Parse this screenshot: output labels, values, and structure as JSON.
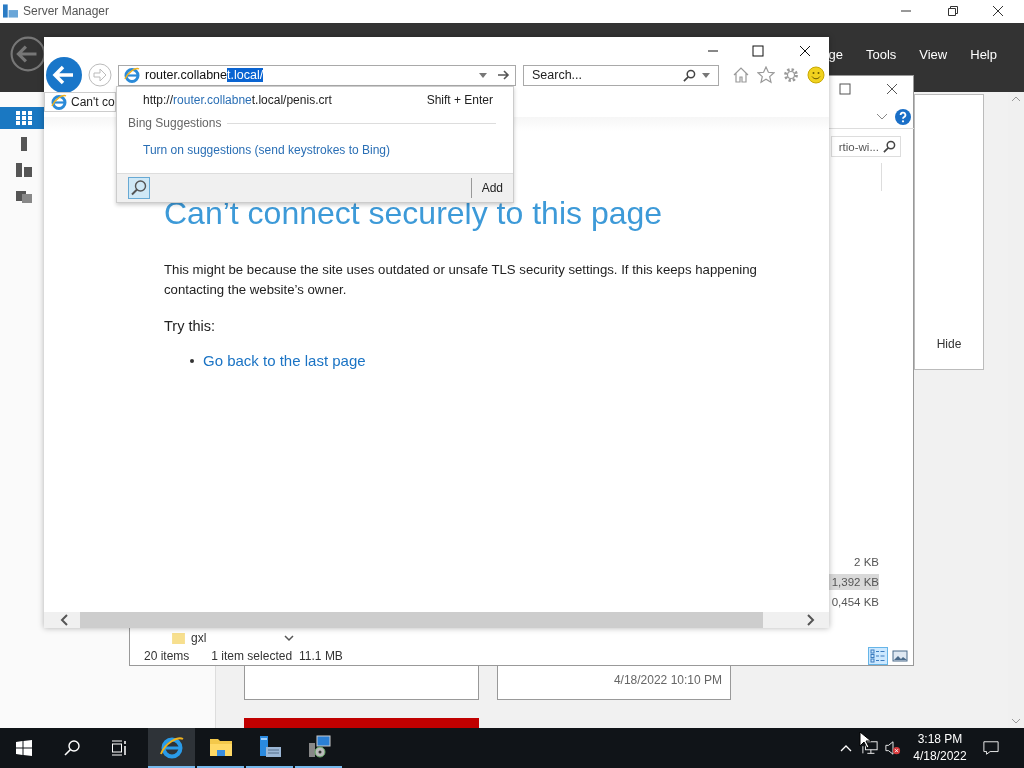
{
  "server_manager": {
    "title": "Server Manager",
    "menu": [
      "ge",
      "Tools",
      "View",
      "Help"
    ],
    "sidebar": [
      {
        "selected": true
      },
      {
        "selected": false
      },
      {
        "selected": false
      },
      {
        "selected": false
      }
    ],
    "hide_button": "Hide",
    "tile_date": "4/18/2022 10:10 PM"
  },
  "explorer": {
    "search_value": "rtio-wi...",
    "sizes": [
      {
        "text": "2 KB",
        "selected": false
      },
      {
        "text": "1,392 KB",
        "selected": true
      },
      {
        "text": "0,454 KB",
        "selected": false
      }
    ],
    "folder_row": "gxl",
    "item_count": "20 items",
    "selection_info": "1 item selected",
    "selection_size": "11.1 MB",
    "views": [
      {
        "selected": true
      },
      {
        "selected": false
      }
    ]
  },
  "browser": {
    "address": {
      "before": "router.collabne",
      "selected": "t.local/"
    },
    "search_placeholder": "Search...",
    "tab": "Can't co",
    "heading": "Can’t connect securely to this page",
    "message_lines": [
      "This might be because the site uses outdated or unsafe TLS security settings. If this keeps happening",
      "contacting the website’s owner."
    ],
    "try_label": "Try this:",
    "links": [
      "Go back to the last page"
    ],
    "dropdown": {
      "suggestion": {
        "prefix": "http://",
        "match": "router.collabne",
        "suffix": "t.local/penis.crt",
        "shortcut": "Shift + Enter"
      },
      "section": "Bing Suggestions",
      "action": "Turn on suggestions (send keystrokes to Bing)",
      "add": "Add"
    }
  },
  "taskbar": {
    "apps": [
      {
        "kind": "browser",
        "selected": true
      },
      {
        "kind": "folder",
        "selected": false
      },
      {
        "kind": "server",
        "selected": false
      },
      {
        "kind": "installer",
        "selected": false
      }
    ],
    "time": "3:18 PM",
    "date": "4/18/2022"
  }
}
